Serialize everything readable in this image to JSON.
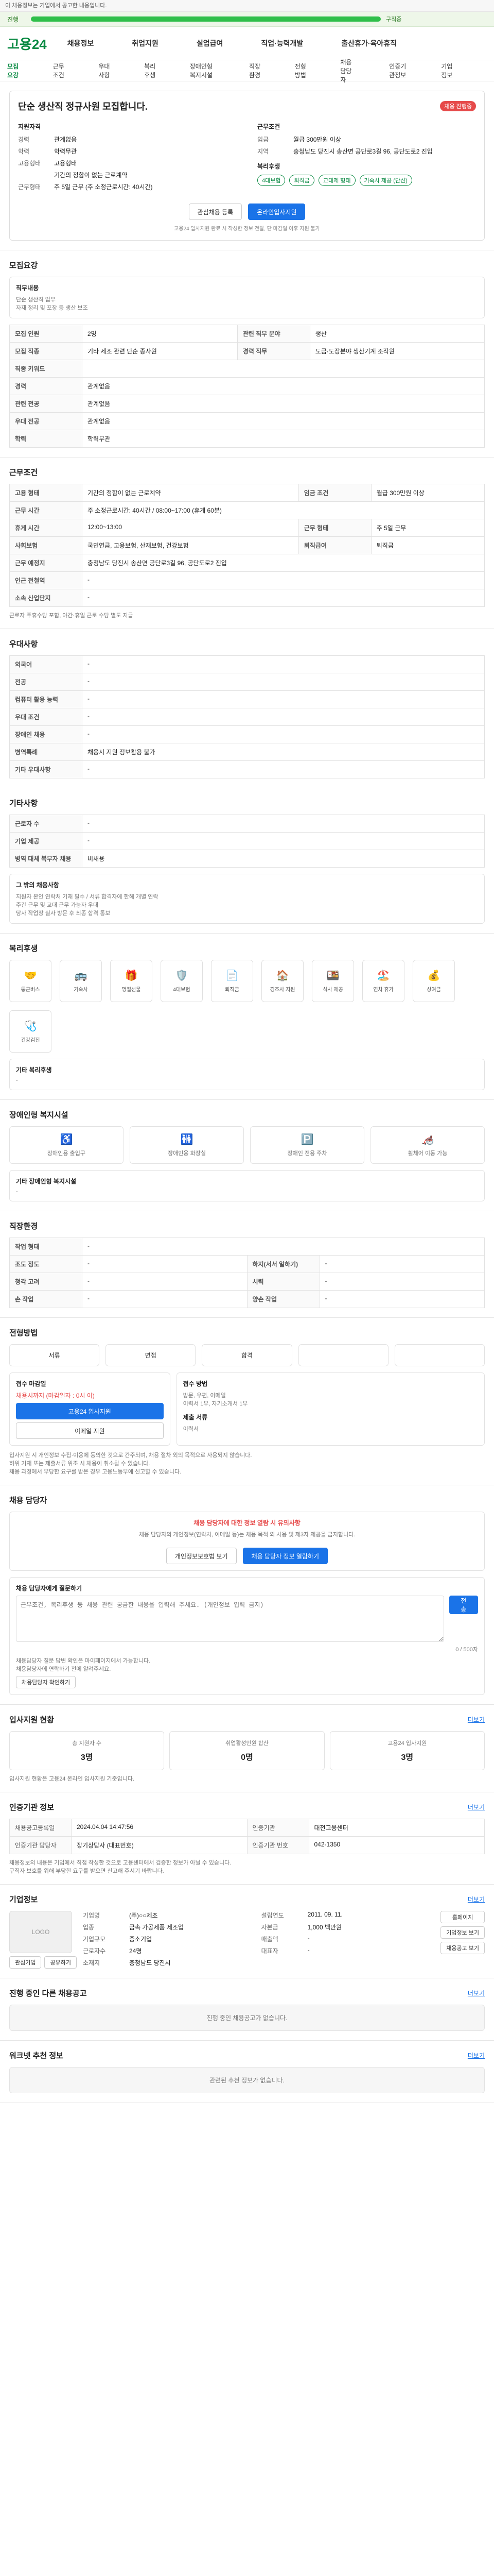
{
  "top_notice": "이 채용정보는 기업에서 공고한 내용입니다.",
  "progress": {
    "label": "진행",
    "value_percent": 78,
    "status": "구직중"
  },
  "header": {
    "logo": "고용24",
    "nav": [
      "채용정보",
      "취업지원",
      "실업급여",
      "직업·능력개발",
      "출산휴가·육아휴직"
    ]
  },
  "subnav": [
    "모집요강",
    "근무조건",
    "우대사항",
    "복리후생",
    "장애인형 복지시설",
    "직장환경",
    "전형방법",
    "채용담당자",
    "인증기관정보",
    "기업정보"
  ],
  "summary": {
    "title": "단순 생산직 정규사원 모집합니다.",
    "badge": "채용 진행중",
    "left": {
      "head": "지원자격",
      "rows": [
        {
          "k": "경력",
          "v": "관계없음"
        },
        {
          "k": "학력",
          "v": "학력무관"
        },
        {
          "k": "고용형태",
          "v": "고용형태"
        },
        {
          "k": "",
          "v": "기간의 정함이 없는 근로계약"
        },
        {
          "k": "근무형태",
          "v": "주 5일 근무 (주 소정근로시간: 40시간)"
        }
      ]
    },
    "right": {
      "head": "근무조건",
      "rows": [
        {
          "k": "임금",
          "v": "월급 300만원 이상"
        },
        {
          "k": "지역",
          "v": "충청남도 당진시 송산면 공단로3길 96, 공단도로2 진입"
        }
      ],
      "chips_head": "복리후생",
      "chips": [
        "4대보험",
        "퇴직금",
        "교대제 형태",
        "기숙사 제공 (단신)"
      ]
    },
    "buttons": {
      "apply": "온라인입사지원",
      "save": "관심채용 등록"
    },
    "footnote": "고용24 입사지원 완료 시 작성한 정보 전달, 단 마감일 이후 지원 불가"
  },
  "recruitment": {
    "title": "모집요강",
    "job_head": "직무내용",
    "job_line1": "단순 생산직 업무",
    "job_line2": "자재 정리 및 포장 등 생산 보조",
    "table": [
      {
        "k": "모집 인원",
        "v": "2명"
      },
      {
        "k": "모집 직종",
        "v": "기타 제조 관련 단순 종사원"
      },
      {
        "k": "직종 키워드",
        "v": ""
      },
      {
        "k": "경력",
        "v": "관계없음"
      },
      {
        "k": "관련 전공",
        "v": "관계없음"
      },
      {
        "k": "우대 전공",
        "v": "관계없음"
      },
      {
        "k": "학력",
        "v": "학력무관"
      }
    ],
    "extra_table": [
      {
        "k": "관련 직무 분야",
        "v": "생산"
      },
      {
        "k": "경력 직무",
        "v": "도금·도장분야 생산기계 조작원"
      }
    ]
  },
  "conditions": {
    "title": "근무조건",
    "rows": [
      {
        "k": "고용 형태",
        "v": "기간의 정함이 없는 근로계약",
        "k2": "임금 조건",
        "v2": "월급 300만원 이상"
      },
      {
        "k": "근무 시간",
        "v": "주 소정근로시간: 40시간 / 08:00~17:00 (휴게 60분)",
        "k2": "",
        "v2": ""
      },
      {
        "k": "휴게 시간",
        "v": "12:00~13:00",
        "k2": "근무 형태",
        "v2": "주 5일 근무"
      },
      {
        "k": "사회보험",
        "v": "국민연금, 고용보험, 산재보험, 건강보험",
        "k2": "퇴직급여",
        "v2": "퇴직금"
      },
      {
        "k": "근무 예정지",
        "v": "충청남도 당진시 송산면 공단로3길 96, 공단도로2 진입",
        "k2": "",
        "v2": ""
      },
      {
        "k": "인근 전철역",
        "v": "-",
        "k2": "",
        "v2": ""
      },
      {
        "k": "소속 산업단지",
        "v": "-",
        "k2": "",
        "v2": ""
      }
    ],
    "note": "근로자 주휴수당 포함, 야간·휴일 근로 수당 별도 지급"
  },
  "preferences": {
    "title": "우대사항",
    "rows": [
      {
        "k": "외국어",
        "v": "-"
      },
      {
        "k": "전공",
        "v": "-"
      },
      {
        "k": "컴퓨터 활용 능력",
        "v": "-"
      },
      {
        "k": "우대 조건",
        "v": "-"
      },
      {
        "k": "장애인 채용",
        "v": "-"
      },
      {
        "k": "병역특례",
        "v": "채용시 지원 정보활용 불가"
      },
      {
        "k": "기타 우대사항",
        "v": "-"
      }
    ]
  },
  "others": {
    "title": "기타사항",
    "rows": [
      {
        "k": "근로자 수",
        "v": "-"
      },
      {
        "k": "기업 제공",
        "v": "-"
      },
      {
        "k": "병역 대체 복무자 채용",
        "v": "비채용"
      }
    ],
    "box_title": "그 밖의 채용사항",
    "box_lines": [
      "지원자 본인 연락처 기재 필수 / 서류 합격자에 한해 개별 연락",
      "주간 근무 및 교대 근무 가능자 우대",
      "당사 작업장 실사 방문 후 최종 합격 통보"
    ]
  },
  "welfare": {
    "title": "복리후생",
    "icons": [
      {
        "icon": "handshake-icon",
        "label": "통근버스"
      },
      {
        "icon": "car-icon",
        "label": "기숙사"
      },
      {
        "icon": "gift-icon",
        "label": "명절선물"
      },
      {
        "icon": "shield-icon",
        "label": "4대보험"
      },
      {
        "icon": "document-icon",
        "label": "퇴직금"
      },
      {
        "icon": "dorm-icon",
        "label": "경조사 지원"
      },
      {
        "icon": "meal-icon",
        "label": "식사 제공"
      },
      {
        "icon": "vacation-icon",
        "label": "연차 휴가"
      },
      {
        "icon": "bonus-icon",
        "label": "상여금"
      },
      {
        "icon": "clinic-icon",
        "label": "건강검진"
      }
    ],
    "other": "기타 복리후생",
    "other_value": "-"
  },
  "disability": {
    "title": "장애인형 복지시설",
    "icons": [
      {
        "icon": "ramp-icon",
        "label": "장애인용 출입구"
      },
      {
        "icon": "restroom-icon",
        "label": "장애인용 화장실"
      },
      {
        "icon": "parking-icon",
        "label": "장애인 전용 주차"
      },
      {
        "icon": "wheelchair-icon",
        "label": "휠체어 이동 가능"
      }
    ],
    "other": "기타 장애인형 복지시설",
    "other_value": "-"
  },
  "environment": {
    "title": "직장환경",
    "rows": [
      {
        "k": "작업 형태",
        "v": "-",
        "k2": "",
        "v2": ""
      },
      {
        "k": "조도 정도",
        "v": "-",
        "k2": "하지(서서 일하기)",
        "v2": "-"
      },
      {
        "k": "청각 고려",
        "v": "-",
        "k2": "시력",
        "v2": "-"
      },
      {
        "k": "손 작업",
        "v": "-",
        "k2": "양손 작업",
        "v2": "-"
      }
    ]
  },
  "process": {
    "title": "전형방법",
    "steps": [
      "서류",
      "면접",
      "합격",
      "",
      ""
    ],
    "apply_box": {
      "title": "접수 마감일",
      "deadline": "채용시까지 (마감일자 : 0시 이)",
      "btn_online": "고용24 입사지원",
      "btn_email": "이메일 지원",
      "right_title": "접수 방법",
      "right_lines": [
        "방문, 우편, 이메일",
        "이력서 1부, 자기소개서 1부"
      ],
      "right_head2": "제출 서류",
      "right_value2": "이력서"
    },
    "notice_lines": [
      "입사지원 시 개인정보 수집·이용에 동의한 것으로 간주되며, 채용 절차 외의 목적으로 사용되지 않습니다.",
      "허위 기재 또는 제출서류 위조 시 채용이 취소될 수 있습니다.",
      "채용 과정에서 부당한 요구를 받은 경우 고용노동부에 신고할 수 있습니다."
    ]
  },
  "hr_contact": {
    "title": "채용 담당자",
    "alert": "채용 담당자에 대한 정보 열람 시 유의사항",
    "alert_desc": "채용 담당자의 개인정보(연락처, 이메일 등)는 채용 목적 외 사용 및 제3자 제공을 금지합니다.",
    "buttons": [
      "개인정보보호법 보기",
      "채용 담당자 정보 열람하기"
    ],
    "question_title": "채용 담당자에게 질문하기",
    "question_placeholder": "근무조건, 복리후생 등 채용 관련 궁금한 내용을 입력해 주세요. (개인정보 입력 금지)",
    "submit": "전송",
    "counter": "0 / 500자",
    "notes": [
      "채용담당자 질문 답변 확인은 마이페이지에서 가능합니다.",
      "채용담당자에 연락하기 전에 알려주세요."
    ],
    "confirm_btn": "채용담당자 확인하기"
  },
  "stats": {
    "title": "입사지원 현황",
    "more": "더보기",
    "cards": [
      {
        "label": "총 지원자 수",
        "value": "3명"
      },
      {
        "label": "취업활성인원 합산",
        "value": "0명"
      },
      {
        "label": "고용24 입사지원",
        "value": "3명"
      }
    ],
    "note": "입사지원 현황은 고용24 온라인 입사지원 기준입니다."
  },
  "cert": {
    "title": "인증기관 정보",
    "more": "더보기",
    "rows": [
      {
        "k": "채용공고등록일",
        "v": "2024.04.04 14:47:56",
        "k2": "인증기관",
        "v2": "대전고용센터"
      },
      {
        "k": "인증기관 담당자",
        "v": "장기상담사 (대표번호)",
        "k2": "인증기관 번호",
        "v2": "042-1350"
      }
    ],
    "notes": [
      "채용정보의 내용은 기업에서 직접 작성한 것으로 고용센터에서 검증한 정보가 아닐 수 있습니다.",
      "구직자 보호를 위해 부당한 요구를 받으면 신고해 주시기 바랍니다."
    ]
  },
  "company": {
    "title": "기업정보",
    "more": "더보기",
    "logo_text": "LOGO",
    "btn_like": "관심기업",
    "btn_share": "공유하기",
    "grid": [
      {
        "k": "기업명",
        "v": "(주)○○제조"
      },
      {
        "k": "설립연도",
        "v": "2011. 09. 11."
      },
      {
        "k": "업종",
        "v": "금속 가공제품 제조업"
      },
      {
        "k": "자본금",
        "v": "1,000 백만원"
      },
      {
        "k": "기업규모",
        "v": "중소기업"
      },
      {
        "k": "매출액",
        "v": "-"
      },
      {
        "k": "근로자수",
        "v": "24명"
      },
      {
        "k": "대표자",
        "v": "-"
      },
      {
        "k": "소재지",
        "v": "충청남도 당진시"
      },
      {
        "k": "",
        "v": ""
      }
    ],
    "right_buttons": [
      "홈페이지",
      "기업정보 보기",
      "채용공고 보기"
    ]
  },
  "same_company": {
    "title": "진행 중인 다른 채용공고",
    "more": "더보기",
    "empty": "진행 중인 채용공고가 없습니다."
  },
  "reviews": {
    "title": "워크넷 추천 정보",
    "more": "더보기",
    "empty": "관련된 추천 정보가 없습니다."
  }
}
